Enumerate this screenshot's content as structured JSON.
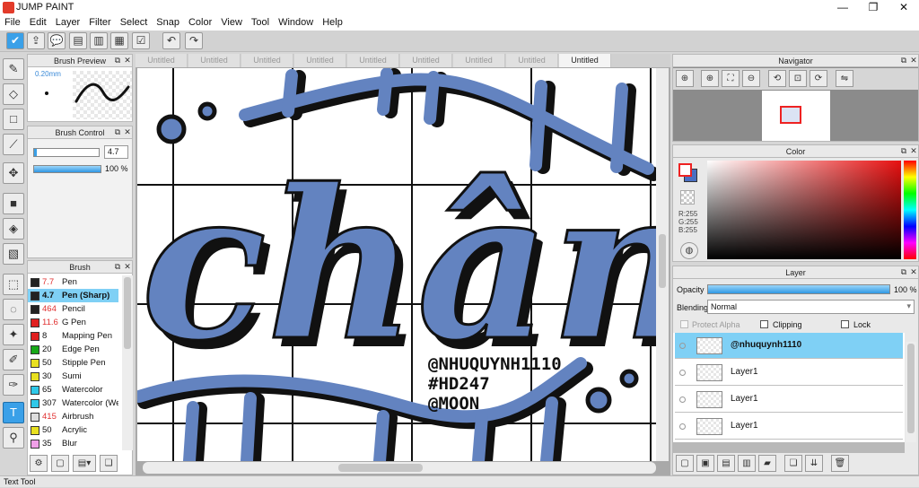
{
  "window": {
    "title": "JUMP PAINT",
    "minimize": "—",
    "maximize": "❐",
    "close": "✕"
  },
  "menu": [
    "File",
    "Edit",
    "Layer",
    "Filter",
    "Select",
    "Snap",
    "Color",
    "View",
    "Tool",
    "Window",
    "Help"
  ],
  "brush_preview": {
    "title": "Brush Preview",
    "size_label": "0.20mm"
  },
  "brush_control": {
    "title": "Brush Control",
    "size_value": "4.7",
    "opacity_value": "100 %",
    "opacity_fraction": 1.0
  },
  "brush_list": {
    "title": "Brush",
    "items": [
      {
        "size": "7.7",
        "name": "Pen",
        "color": "#222222",
        "size_red": true
      },
      {
        "size": "4.7",
        "name": "Pen (Sharp)",
        "color": "#222222",
        "size_red": false
      },
      {
        "size": "464",
        "name": "Pencil",
        "color": "#222222",
        "size_red": true
      },
      {
        "size": "11.6",
        "name": "G Pen",
        "color": "#e02020",
        "size_red": true
      },
      {
        "size": "8",
        "name": "Mapping Pen",
        "color": "#e02020",
        "size_red": false
      },
      {
        "size": "20",
        "name": "Edge Pen",
        "color": "#18a818",
        "size_red": false
      },
      {
        "size": "50",
        "name": "Stipple Pen",
        "color": "#e8e020",
        "size_red": false
      },
      {
        "size": "30",
        "name": "Sumi",
        "color": "#e8e020",
        "size_red": false
      },
      {
        "size": "65",
        "name": "Watercolor",
        "color": "#30c8e8",
        "size_red": false
      },
      {
        "size": "307",
        "name": "Watercolor (Wet)",
        "color": "#30c8e8",
        "size_red": false
      },
      {
        "size": "415",
        "name": "Airbrush",
        "color": "#dddddd",
        "size_red": true
      },
      {
        "size": "50",
        "name": "Acrylic",
        "color": "#e8e020",
        "size_red": false
      },
      {
        "size": "35",
        "name": "Blur",
        "color": "#f0a0e8",
        "size_red": false
      }
    ]
  },
  "tabs": [
    "Untitled",
    "Untitled",
    "Untitled",
    "Untitled",
    "Untitled",
    "Untitled",
    "Untitled",
    "Untitled",
    "Untitled"
  ],
  "active_tab_index": 8,
  "artwork": {
    "text_lines": [
      "@NHUQUYNH1110",
      "#HD247",
      "@MOON"
    ]
  },
  "navigator": {
    "title": "Navigator"
  },
  "color_panel": {
    "title": "Color",
    "r": "R:255",
    "g": "G:255",
    "b": "B:255"
  },
  "layer_panel": {
    "title": "Layer",
    "opacity_label": "Opacity",
    "opacity_value": "100 %",
    "opacity_fraction": 1.0,
    "blending_label": "Blending",
    "blending_value": "Normal",
    "protect_alpha": "Protect Alpha",
    "clipping": "Clipping",
    "lock": "Lock",
    "layers": [
      {
        "name": "@nhuquynh1110",
        "selected": true
      },
      {
        "name": "Layer1",
        "selected": false
      },
      {
        "name": "Layer1",
        "selected": false
      },
      {
        "name": "Layer1",
        "selected": false
      }
    ]
  },
  "status": {
    "text": "Text Tool"
  },
  "colors": {
    "accent": "#3aa0e8",
    "selection": "#7fd0f5",
    "art_blue": "#6383c0"
  }
}
